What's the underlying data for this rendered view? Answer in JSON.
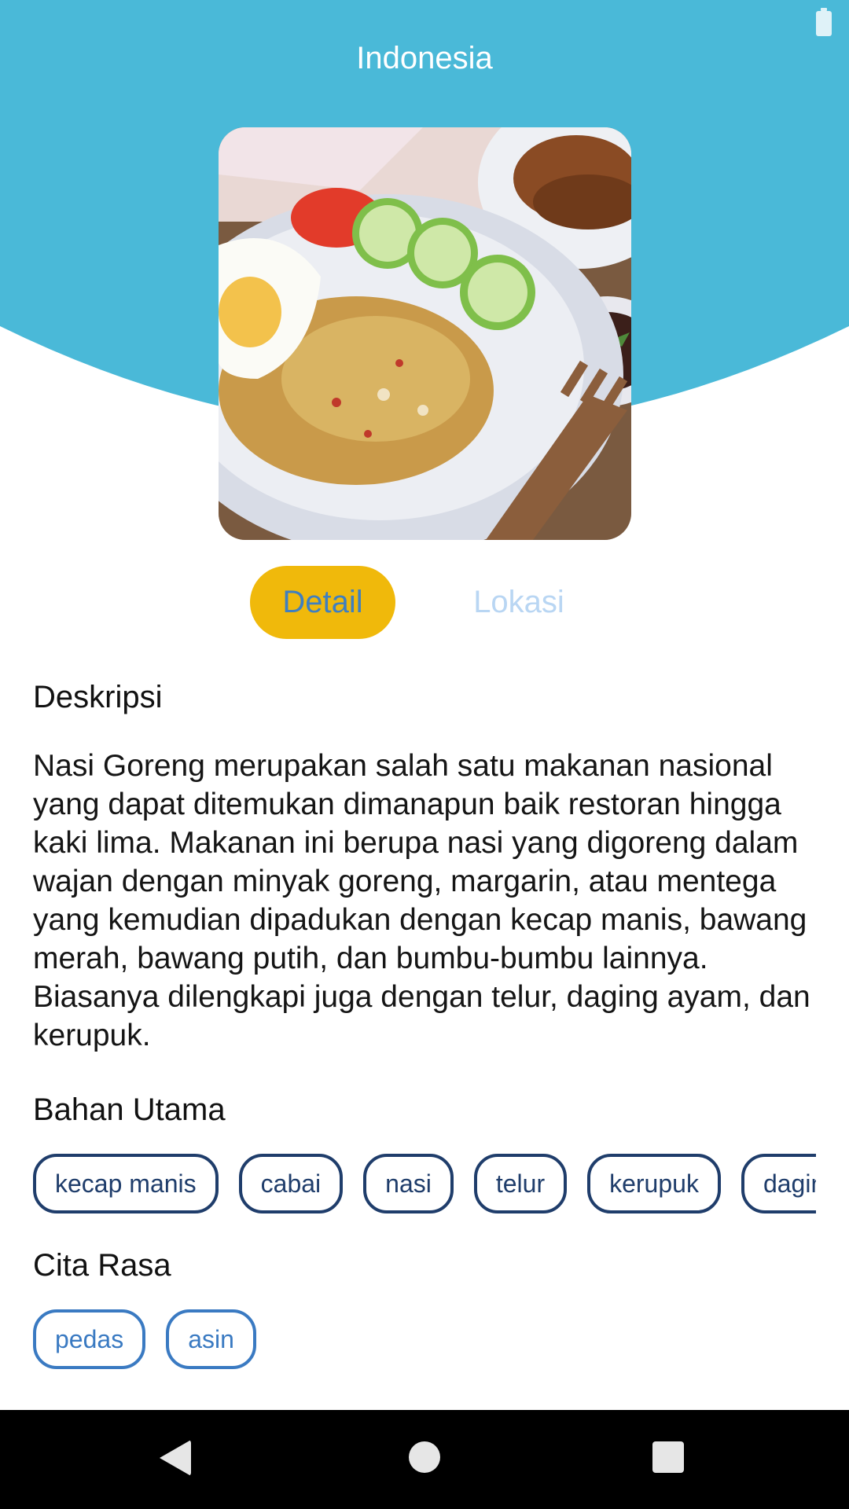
{
  "header": {
    "title": "Indonesia",
    "background_color": "#4ab9d8"
  },
  "status_bar": {
    "icons": [
      "battery-icon"
    ]
  },
  "tabs": [
    {
      "label": "Detail",
      "active": true,
      "color": "#f0b90b"
    },
    {
      "label": "Lokasi",
      "active": false
    }
  ],
  "description": {
    "heading": "Deskripsi",
    "text": "Nasi Goreng merupakan salah satu makanan nasional yang dapat ditemukan dimanapun baik restoran hingga kaki lima. Makanan ini berupa nasi yang digoreng dalam wajan dengan minyak goreng, margarin, atau mentega yang kemudian dipadukan dengan kecap manis, bawang merah, bawang putih, dan bumbu-bumbu lainnya. Biasanya dilengkapi juga dengan telur, daging ayam, dan kerupuk."
  },
  "ingredients": {
    "heading": "Bahan Utama",
    "items": [
      "kecap manis",
      "cabai",
      "nasi",
      "telur",
      "kerupuk",
      "daging ayam"
    ]
  },
  "flavors": {
    "heading": "Cita Rasa",
    "items": [
      "pedas",
      "asin"
    ]
  },
  "nav_bar": {
    "icons": [
      "back-icon",
      "home-icon",
      "recents-icon"
    ]
  }
}
